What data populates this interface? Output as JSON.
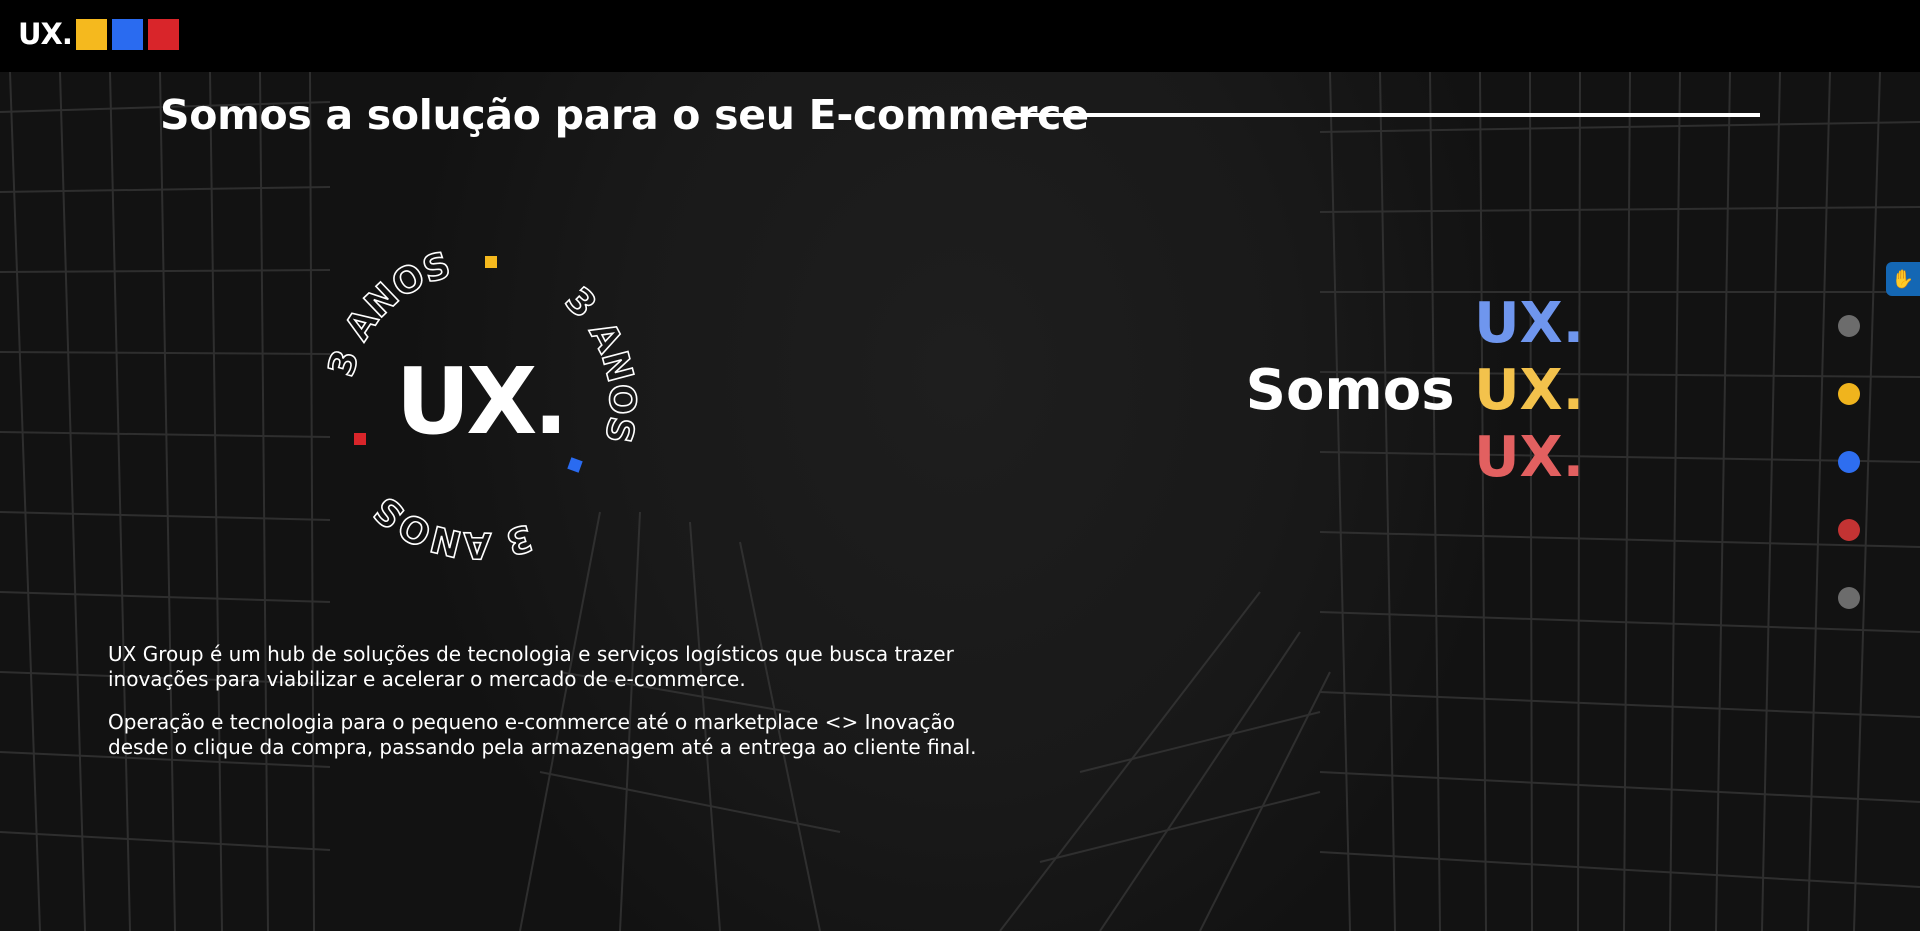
{
  "header": {
    "logo_text": "UX.",
    "logo_colors": [
      "#f5b91e",
      "#2a6bf0",
      "#d9252a"
    ]
  },
  "hero": {
    "headline": "Somos a solução para o seu E-commerce"
  },
  "badge": {
    "center_text": "UX.",
    "ring_text": "3 ANOS",
    "marker_colors": [
      "#f5b91e",
      "#2a6bf0",
      "#d9252a"
    ]
  },
  "rotating": {
    "line1_ux": "UX.",
    "prefix": "Somos",
    "line2_ux": "UX.",
    "line3_ux": "UX.",
    "colors": {
      "blue": "#6f96ee",
      "yellow": "#f3c24c",
      "red": "#e26060"
    }
  },
  "nav_dots": [
    {
      "color": "#6c6c6c"
    },
    {
      "color": "#f0b41d"
    },
    {
      "color": "#2e6ef0"
    },
    {
      "color": "#c33333"
    },
    {
      "color": "#6c6c6c"
    }
  ],
  "accessibility": {
    "icon": "sign-language-icon"
  },
  "about": {
    "paragraph1": "UX Group é um hub de soluções de tecnologia e serviços logísticos que busca trazer inovações para viabilizar e acelerar o mercado de e-commerce.",
    "paragraph2": "Operação e tecnologia para o pequeno e-commerce até o marketplace <> Inovação desde o clique da compra, passando pela armazenagem até a entrega ao cliente final."
  }
}
